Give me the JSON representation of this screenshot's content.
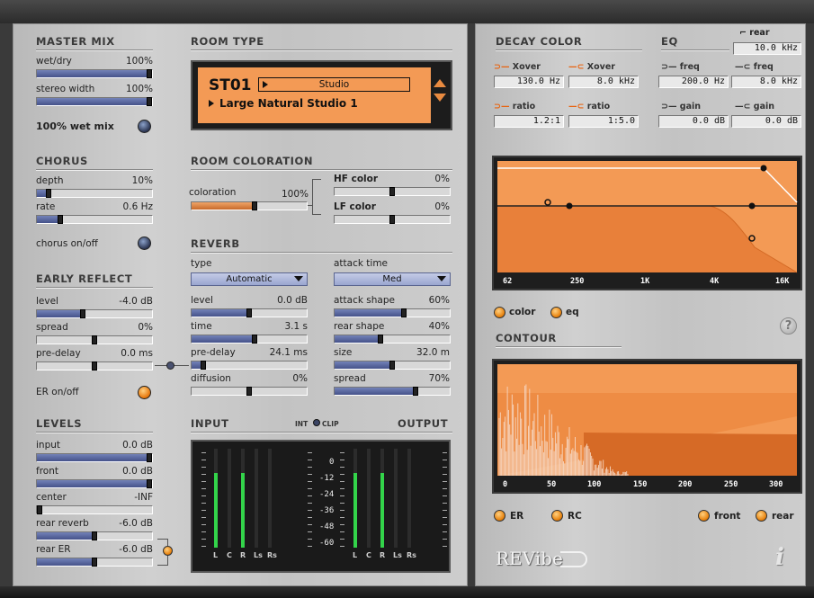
{
  "master_mix": {
    "title": "MASTER MIX",
    "wet_dry": {
      "label": "wet/dry",
      "value": "100%",
      "level": 1.0
    },
    "stereo_width": {
      "label": "stereo width",
      "value": "100%",
      "level": 1.0
    },
    "wet_mix": {
      "label": "100% wet mix",
      "on": false
    }
  },
  "chorus": {
    "title": "CHORUS",
    "depth": {
      "label": "depth",
      "value": "10%",
      "level": 0.1
    },
    "rate": {
      "label": "rate",
      "value": "0.6 Hz",
      "level": 0.2
    },
    "onoff": {
      "label": "chorus on/off",
      "on": false
    }
  },
  "early_reflect": {
    "title": "EARLY REFLECT",
    "level": {
      "label": "level",
      "value": "-4.0 dB",
      "level": 0.4
    },
    "spread": {
      "label": "spread",
      "value": "0%",
      "level": 0.5
    },
    "predelay": {
      "label": "pre-delay",
      "value": "0.0 ms",
      "level": 0.5
    },
    "onoff": {
      "label": "ER on/off",
      "on": true
    }
  },
  "levels": {
    "title": "LEVELS",
    "input": {
      "label": "input",
      "value": "0.0 dB",
      "level": 1.0
    },
    "front": {
      "label": "front",
      "value": "0.0 dB",
      "level": 1.0
    },
    "center": {
      "label": "center",
      "value": "-INF",
      "level": 0.0
    },
    "rear_reverb": {
      "label": "rear reverb",
      "value": "-6.0 dB",
      "level": 0.5
    },
    "rear_er": {
      "label": "rear ER",
      "value": "-6.0 dB",
      "level": 0.5
    }
  },
  "room_type": {
    "title": "ROOM TYPE",
    "code": "ST01",
    "category": "Studio",
    "preset": "Large Natural Studio 1"
  },
  "room_coloration": {
    "title": "ROOM COLORATION",
    "coloration": {
      "label": "coloration",
      "value": "100%",
      "level": 0.55
    },
    "hf_color": {
      "label": "HF color",
      "value": "0%",
      "level": 0.5
    },
    "lf_color": {
      "label": "LF color",
      "value": "0%",
      "level": 0.5
    }
  },
  "reverb": {
    "title": "REVERB",
    "type": {
      "label": "type",
      "value": "Automatic"
    },
    "attack_time": {
      "label": "attack time",
      "value": "Med"
    },
    "level": {
      "label": "level",
      "value": "0.0 dB",
      "level": 0.5
    },
    "attack_shape": {
      "label": "attack shape",
      "value": "60%",
      "level": 0.6
    },
    "time": {
      "label": "time",
      "value": "3.1 s",
      "level": 0.55
    },
    "rear_shape": {
      "label": "rear shape",
      "value": "40%",
      "level": 0.4
    },
    "predelay": {
      "label": "pre-delay",
      "value": "24.1 ms",
      "level": 0.1
    },
    "size": {
      "label": "size",
      "value": "32.0 m",
      "level": 0.5
    },
    "diffusion": {
      "label": "diffusion",
      "value": "0%",
      "level": 0.5
    },
    "spread": {
      "label": "spread",
      "value": "70%",
      "level": 0.7
    }
  },
  "io": {
    "input_title": "INPUT",
    "output_title": "OUTPUT",
    "int_label": "INT",
    "clip_label": "CLIP",
    "scale": [
      "0",
      "-12",
      "-24",
      "-36",
      "-48",
      "-60"
    ],
    "channels": [
      "L",
      "C",
      "R",
      "Ls",
      "Rs"
    ],
    "input_levels": [
      0.75,
      0,
      0.75,
      0,
      0
    ],
    "output_levels": [
      0.75,
      0,
      0.75,
      0,
      0
    ]
  },
  "decay_color": {
    "title": "DECAY COLOR",
    "low_xover_label": "Xover",
    "low_xover": "130.0 Hz",
    "high_xover_label": "Xover",
    "high_xover": "8.0 kHz",
    "low_ratio_label": "ratio",
    "low_ratio": "1.2:1",
    "high_ratio_label": "ratio",
    "high_ratio": "1:5.0"
  },
  "eq": {
    "title": "EQ",
    "rear_label": "rear",
    "rear": "10.0 kHz",
    "low_freq_label": "freq",
    "low_freq": "200.0 Hz",
    "high_freq_label": "freq",
    "high_freq": "8.0 kHz",
    "low_gain_label": "gain",
    "low_gain": "0.0 dB",
    "high_gain_label": "gain",
    "high_gain": "0.0 dB"
  },
  "freq_graph": {
    "ticks": [
      "62",
      "250",
      "1K",
      "4K",
      "16K"
    ]
  },
  "graph_mode": {
    "color_label": "color",
    "eq_label": "eq"
  },
  "contour": {
    "title": "CONTOUR",
    "ticks": [
      "0",
      "50",
      "100",
      "150",
      "200",
      "250",
      "300"
    ],
    "er_label": "ER",
    "rc_label": "RC",
    "front_label": "front",
    "rear_label": "rear"
  },
  "help": "?",
  "brand": {
    "name": "REVibe"
  },
  "colors": {
    "accent": "#f39a55",
    "panel": "#c6c6c6",
    "slider_fill": "#5a68a0",
    "meter": "#33d44a"
  }
}
